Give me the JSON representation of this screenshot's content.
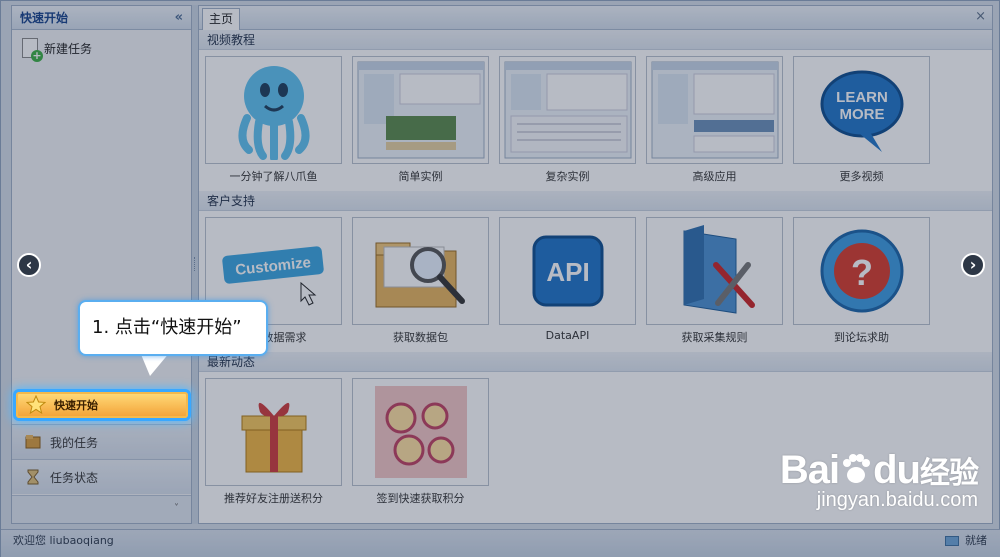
{
  "left_panel": {
    "title": "快速开始",
    "collapse": "«",
    "new_task": "新建任务",
    "accordion": [
      {
        "label": "快速开始",
        "active": true
      },
      {
        "label": "我的任务",
        "active": false
      },
      {
        "label": "任务状态",
        "active": false
      }
    ],
    "footer": "˅"
  },
  "tabs": {
    "active": "主页",
    "close": "×"
  },
  "sections": [
    {
      "title": "视频教程",
      "cards": [
        {
          "label": "一分钟了解八爪鱼",
          "icon": "octopus-mascot"
        },
        {
          "label": "简单实例",
          "icon": "screenshot-simple"
        },
        {
          "label": "复杂实例",
          "icon": "screenshot-complex"
        },
        {
          "label": "高级应用",
          "icon": "screenshot-advanced"
        },
        {
          "label": "更多视频",
          "icon": "learn-more-bubble",
          "icon_text": "LEARN MORE"
        }
      ]
    },
    {
      "title": "客户支持",
      "cards": [
        {
          "label": "提交数据需求",
          "icon": "customize-sign",
          "icon_text": "Customize"
        },
        {
          "label": "获取数据包",
          "icon": "folder-magnifier"
        },
        {
          "label": "DataAPI",
          "icon": "api-badge",
          "icon_text": "API"
        },
        {
          "label": "获取采集规则",
          "icon": "folder-tools"
        },
        {
          "label": "到论坛求助",
          "icon": "question-ball"
        }
      ]
    },
    {
      "title": "最新动态",
      "cards": [
        {
          "label": "推荐好友注册送积分",
          "icon": "gift-box"
        },
        {
          "label": "签到快速获取积分",
          "icon": "points-reward-art"
        }
      ]
    }
  ],
  "navigation": {
    "prev": "‹",
    "next": "›"
  },
  "status_bar": {
    "welcome": "欢迎您 liubaoqiang",
    "state": "就绪"
  },
  "callout": {
    "text": "1. 点击“快速开始”"
  },
  "watermark": {
    "logo": "Bai",
    "logo_mid": "du",
    "logo_cn": "经验",
    "url": "jingyan.baidu.com"
  },
  "colors": {
    "accent": "#39a8ff",
    "active_item": "#f3a53b",
    "header_text": "#15428b"
  }
}
